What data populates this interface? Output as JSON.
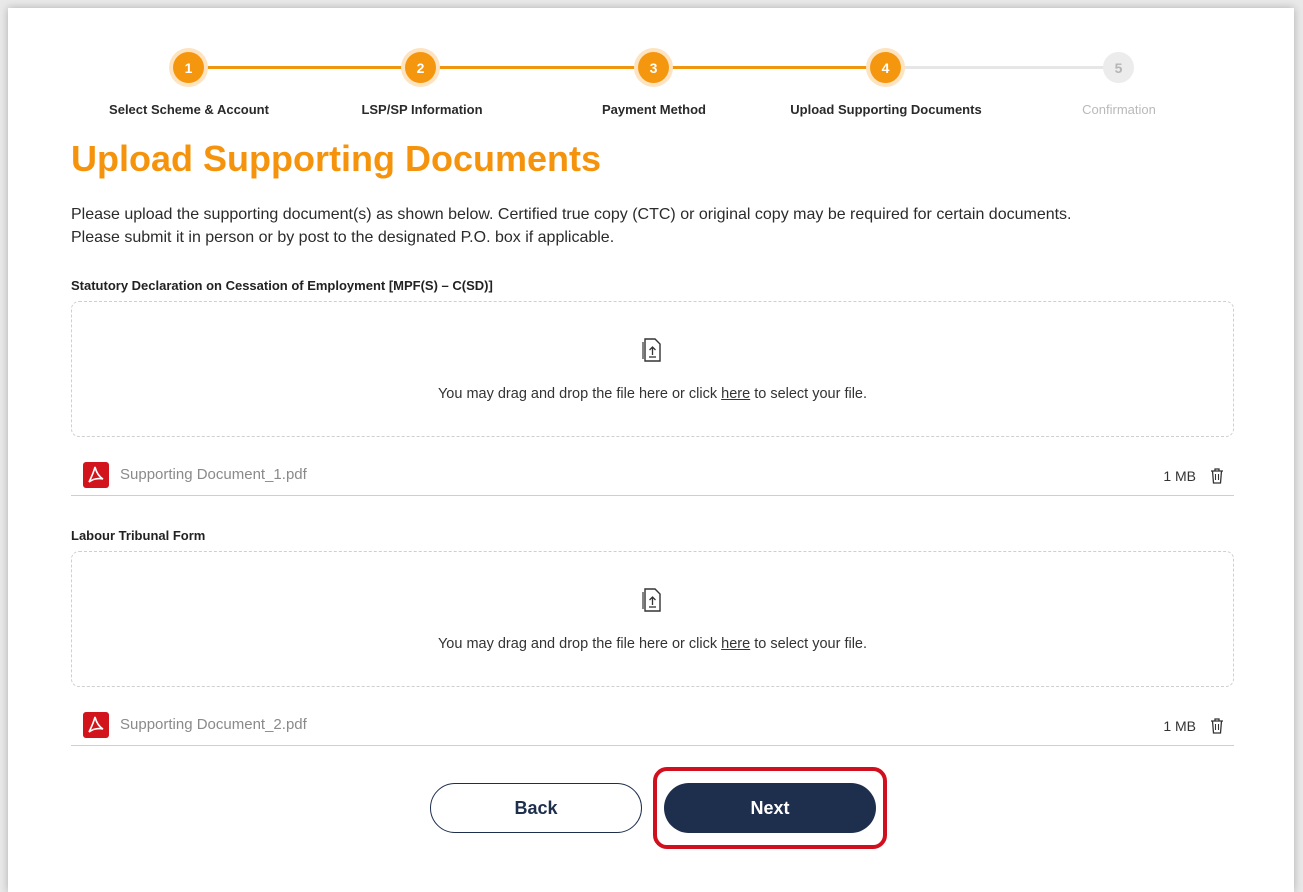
{
  "stepper": {
    "steps": [
      {
        "number": "1",
        "label": "Select Scheme & Account",
        "state": "complete"
      },
      {
        "number": "2",
        "label": "LSP/SP Information",
        "state": "complete"
      },
      {
        "number": "3",
        "label": "Payment Method",
        "state": "complete"
      },
      {
        "number": "4",
        "label": "Upload Supporting Documents",
        "state": "current"
      },
      {
        "number": "5",
        "label": "Confirmation",
        "state": "pending"
      }
    ]
  },
  "page": {
    "title": "Upload Supporting Documents",
    "intro_line1": "Please upload the supporting document(s) as shown below. Certified true copy (CTC) or original copy may be required for certain documents.",
    "intro_line2": "Please submit it in person or by post to the designated P.O. box if applicable."
  },
  "uploads": [
    {
      "label": "Statutory Declaration on Cessation of Employment [MPF(S) – C(SD)]",
      "drop_text_before": "You may drag and drop the file here or click ",
      "drop_link": "here",
      "drop_text_after": " to select your file.",
      "file_name": "Supporting Document_1.pdf",
      "file_size": "1 MB"
    },
    {
      "label": "Labour Tribunal Form",
      "drop_text_before": "You may drag and drop the file here or click ",
      "drop_link": "here",
      "drop_text_after": " to select your file.",
      "file_name": "Supporting Document_2.pdf",
      "file_size": "1 MB"
    }
  ],
  "actions": {
    "back_label": "Back",
    "next_label": "Next"
  },
  "colors": {
    "accent": "#f5940c",
    "primary_button": "#1e2e4d",
    "highlight": "#d0101e",
    "pdf": "#d2141c"
  }
}
